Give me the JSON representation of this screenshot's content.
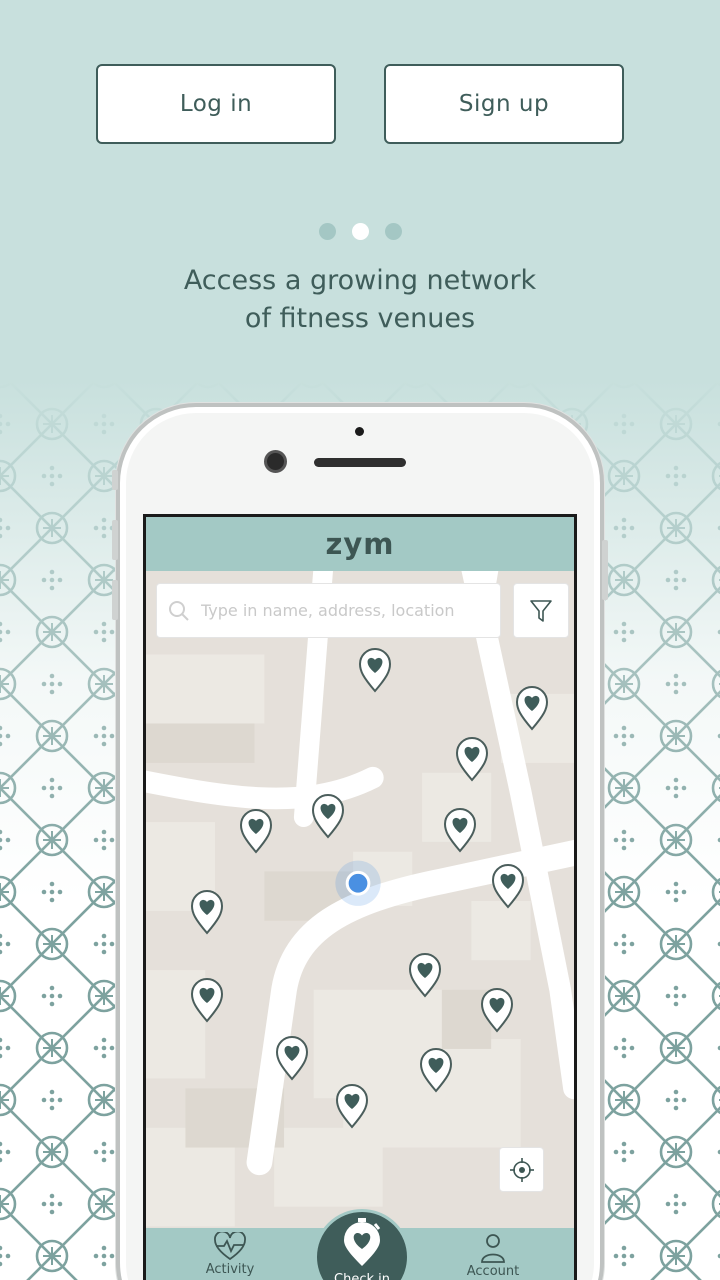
{
  "auth": {
    "login_label": "Log in",
    "signup_label": "Sign up"
  },
  "carousel": {
    "count": 3,
    "active_index": 1
  },
  "tagline": {
    "line1": "Access a growing network",
    "line2": "of fitness venues"
  },
  "app": {
    "name": "zym",
    "search": {
      "placeholder": "Type in name, address, location"
    },
    "tabs": {
      "activity": "Activity",
      "checkin": "Check in",
      "account": "Account"
    }
  },
  "colors": {
    "background": "#c8e0dd",
    "accent_dark": "#3f5d5a",
    "app_bar": "#a3c9c5",
    "user_location": "#4a90e2"
  },
  "icons": [
    "search-icon",
    "filter-icon",
    "locate-icon",
    "heart-pin-icon",
    "heart-pulse-icon",
    "stopwatch-heart-icon",
    "person-icon"
  ]
}
